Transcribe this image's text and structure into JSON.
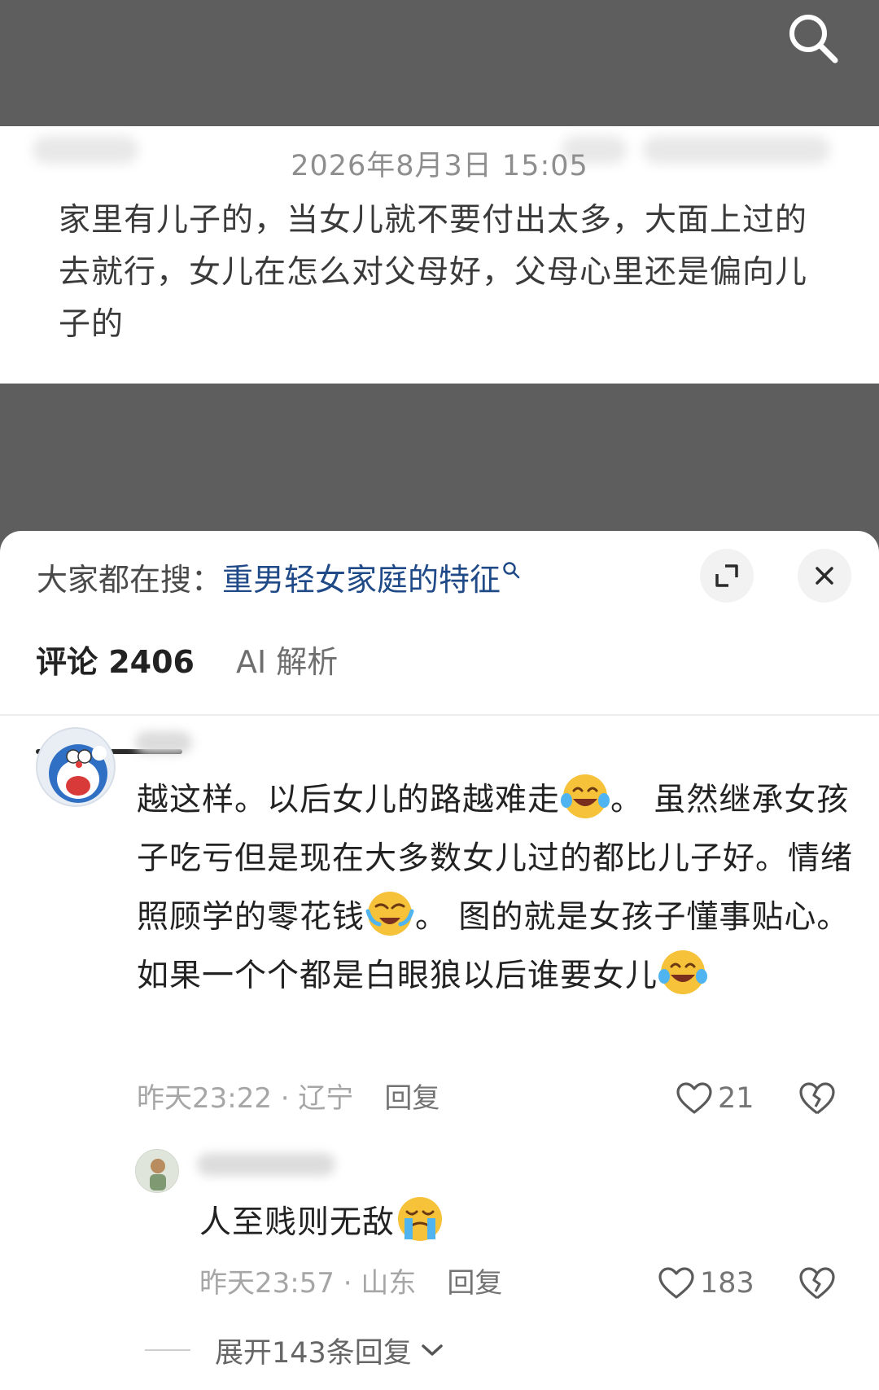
{
  "post": {
    "date": "2026年8月3日 15:05",
    "text": "家里有儿子的，当女儿就不要付出太多，大面上过的去就行，女儿在怎么对父母好，父母心里还是偏向儿子的"
  },
  "hot_search": {
    "prefix": "大家都在搜：",
    "term": "重男轻女家庭的特征"
  },
  "tabs": [
    {
      "label": "评论 2406",
      "active": true
    },
    {
      "label": "AI 解析",
      "active": false
    }
  ],
  "comment": {
    "parts": [
      "越这样。以后女儿的路越难走",
      "。 虽然继承女孩子吃亏但是现在大多数女儿过的都比儿子好。情绪照顾学的零花钱",
      "。 图的就是女孩子懂事贴心。 如果一个个都是白眼狼以后谁要女儿",
      ""
    ],
    "time": "昨天23:22",
    "sep": " · ",
    "location": "辽宁",
    "reply_label": "回复",
    "likes": "21"
  },
  "reply": {
    "text": "人至贱则无敌",
    "time": "昨天23:57",
    "sep": " · ",
    "location": "山东",
    "reply_label": "回复",
    "likes": "183"
  },
  "expand_replies_label": "展开143条回复",
  "colors": {
    "link_blue": "#1f4a87",
    "overlay_gray": "#5e5e5e",
    "emoji_yellow": "#f6c23a"
  },
  "icons": [
    "search-icon",
    "expand-icon",
    "close-icon",
    "heart-icon",
    "broken-heart-icon",
    "chevron-down-icon",
    "tears-of-joy-emoji",
    "crying-emoji"
  ]
}
